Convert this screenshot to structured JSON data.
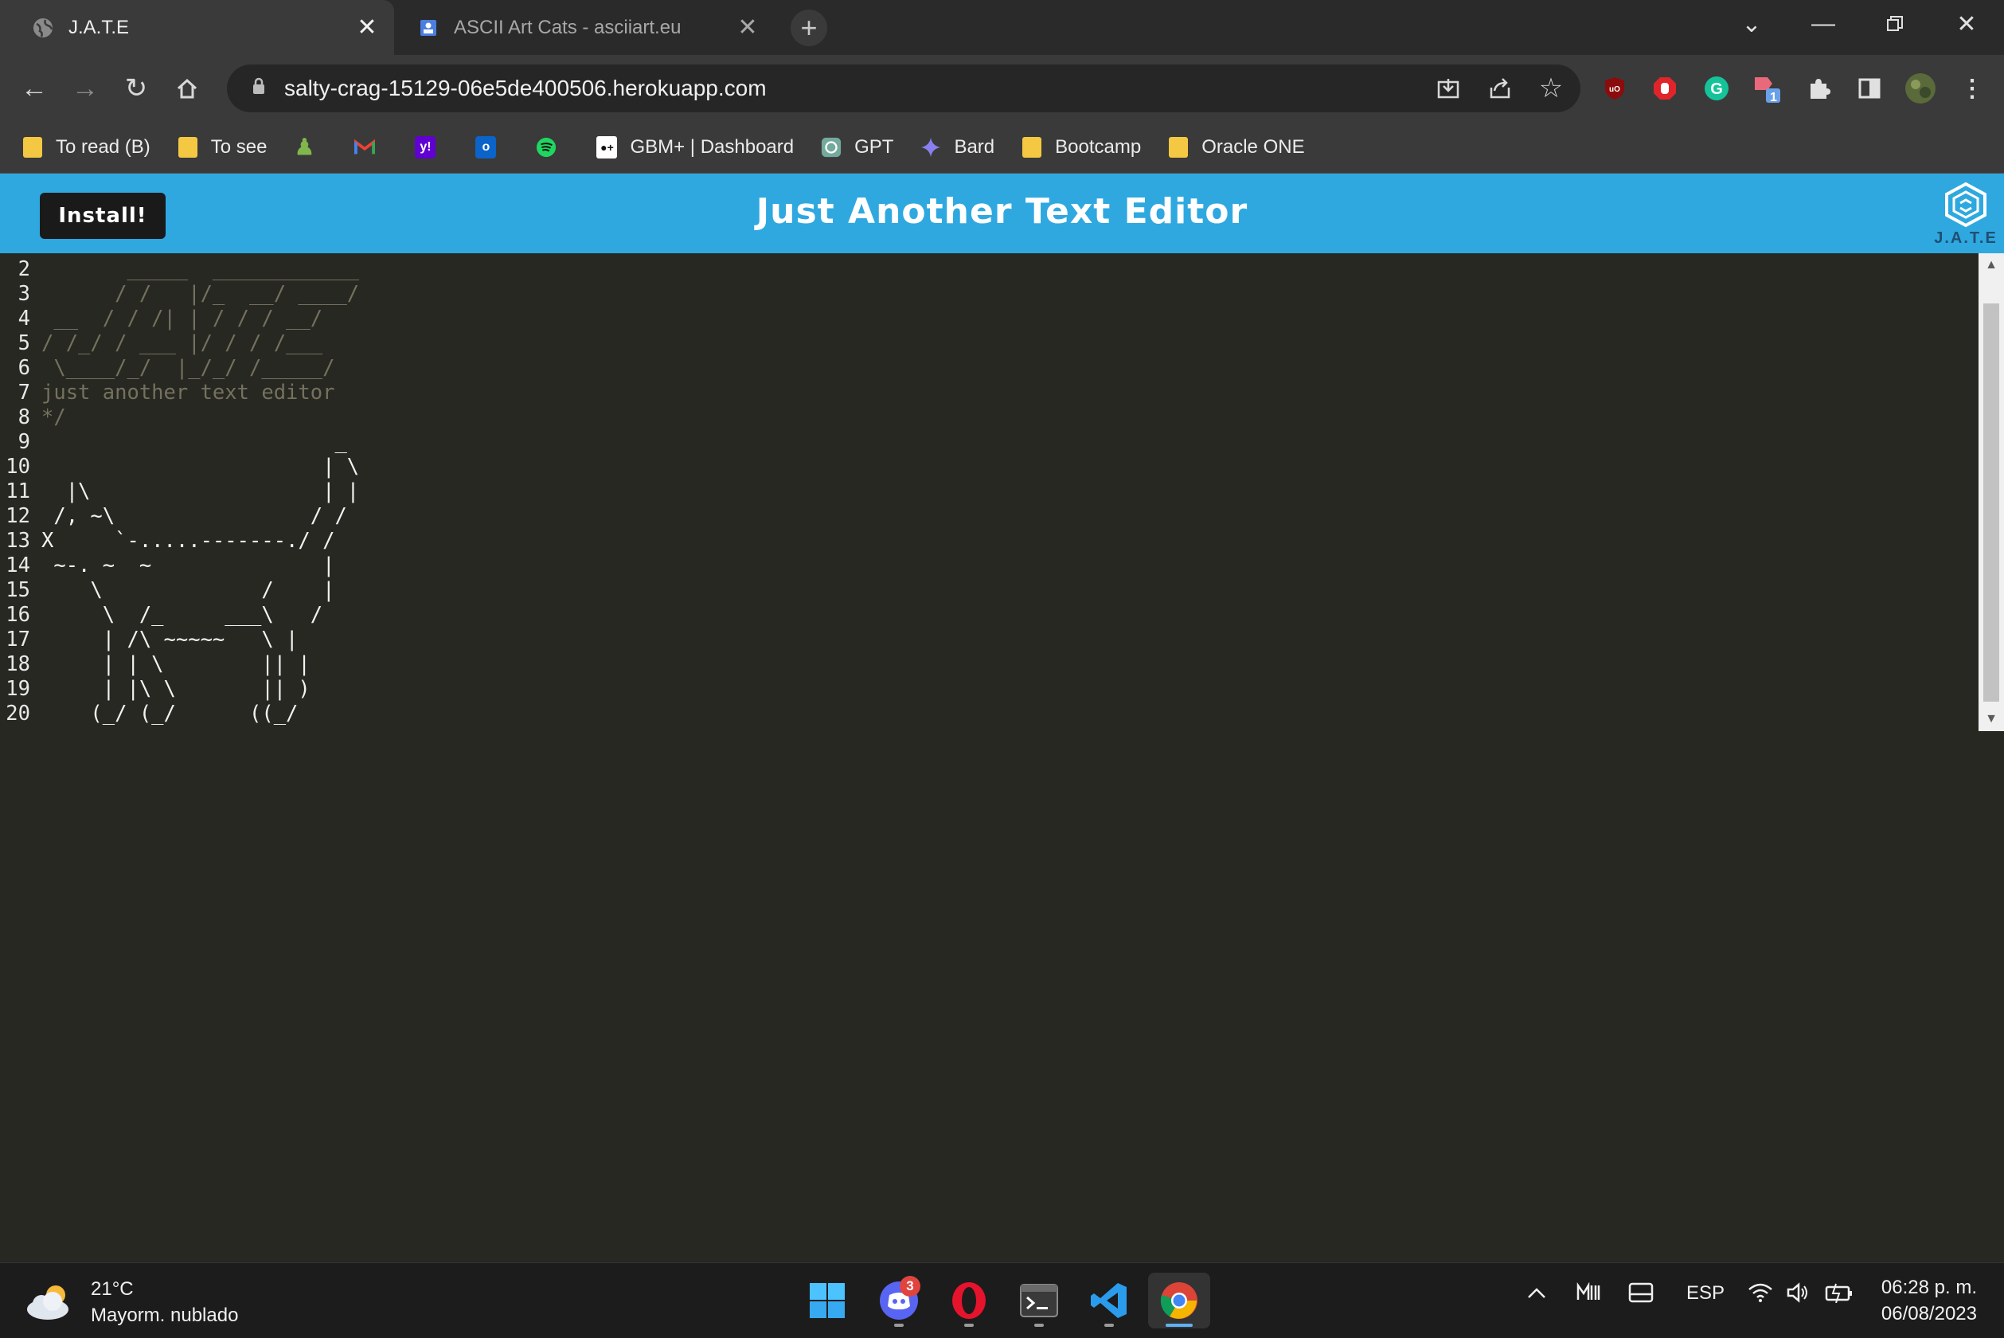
{
  "browser": {
    "tabs": [
      {
        "title": "J.A.T.E",
        "favicon": "globe-icon",
        "active": true
      },
      {
        "title": "ASCII Art Cats - asciiart.eu",
        "favicon": "asciiart-icon",
        "active": false
      }
    ],
    "url": "salty-crag-15129-06e5de400506.herokuapp.com",
    "extension_badge": "1",
    "bookmarks": [
      {
        "label": "To read (B)",
        "icon": "folder-icon"
      },
      {
        "label": "To see",
        "icon": "folder-icon"
      },
      {
        "label": "",
        "icon": "chess-icon"
      },
      {
        "label": "",
        "icon": "gmail-icon"
      },
      {
        "label": "",
        "icon": "yahoo-icon"
      },
      {
        "label": "",
        "icon": "outlook-icon"
      },
      {
        "label": "",
        "icon": "spotify-icon"
      },
      {
        "label": "GBM+ | Dashboard",
        "icon": "gbm-icon"
      },
      {
        "label": "GPT",
        "icon": "openai-icon"
      },
      {
        "label": "Bard",
        "icon": "bard-icon"
      },
      {
        "label": "Bootcamp",
        "icon": "folder-icon"
      },
      {
        "label": "Oracle ONE",
        "icon": "folder-icon"
      }
    ]
  },
  "app": {
    "install_label": "Install!",
    "title": "Just Another Text Editor",
    "logo_text": "J.A.T.E"
  },
  "editor": {
    "lines": [
      {
        "n": "2",
        "text": "       _____  ____________",
        "comment": true
      },
      {
        "n": "3",
        "text": "      / /   |/_  __/ ____/",
        "comment": true
      },
      {
        "n": "4",
        "text": " __  / / /| | / / / __/",
        "comment": true
      },
      {
        "n": "5",
        "text": "/ /_/ / ___ |/ / / /___",
        "comment": true
      },
      {
        "n": "6",
        "text": " \\____/_/  |_/_/ /_____/",
        "comment": true
      },
      {
        "n": "7",
        "text": "just another text editor",
        "comment": true
      },
      {
        "n": "8",
        "text": "*/",
        "comment": true
      },
      {
        "n": "9",
        "text": "                        _",
        "comment": false
      },
      {
        "n": "10",
        "text": "                       | \\",
        "comment": false
      },
      {
        "n": "11",
        "text": "  |\\                   | |",
        "comment": false
      },
      {
        "n": "12",
        "text": " /, ~\\                / /",
        "comment": false
      },
      {
        "n": "13",
        "text": "X     `-.....-------./ /",
        "comment": false
      },
      {
        "n": "14",
        "text": " ~-. ~  ~              |",
        "comment": false
      },
      {
        "n": "15",
        "text": "    \\             /    |",
        "comment": false
      },
      {
        "n": "16",
        "text": "     \\  /_     ___\\   /",
        "comment": false
      },
      {
        "n": "17",
        "text": "     | /\\ ~~~~~   \\ |",
        "comment": false
      },
      {
        "n": "18",
        "text": "     | | \\        || |",
        "comment": false
      },
      {
        "n": "19",
        "text": "     | |\\ \\       || )",
        "comment": false
      },
      {
        "n": "20",
        "text": "    (_/ (_/      ((_/",
        "comment": false
      }
    ]
  },
  "taskbar": {
    "weather_temp": "21°C",
    "weather_desc": "Mayorm. nublado",
    "discord_badge": "3",
    "language": "ESP",
    "time": "06:28 p. m.",
    "date": "06/08/2023"
  }
}
